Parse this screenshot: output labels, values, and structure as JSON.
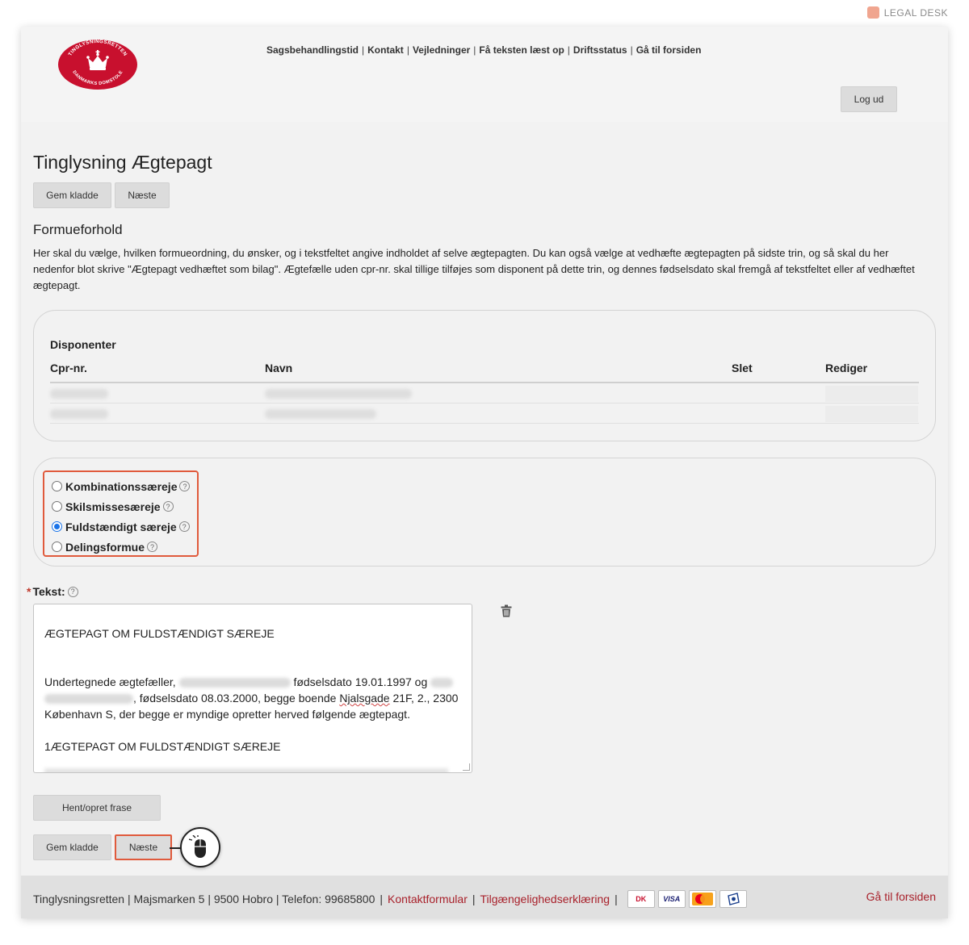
{
  "brand": {
    "legal_desk": "LEGAL DESK"
  },
  "logo": {
    "top_text": "TINGLYSNINGSRETTEN",
    "bottom_text": "DANMARKS DOMSTOLE"
  },
  "topnav": [
    "Sagsbehandlingstid",
    "Kontakt",
    "Vejledninger",
    "Få teksten læst op",
    "Driftsstatus",
    "Gå til forsiden"
  ],
  "header": {
    "logout": "Log ud"
  },
  "page": {
    "title": "Tinglysning Ægtepagt",
    "save_draft": "Gem kladde",
    "next": "Næste",
    "section_title": "Formueforhold",
    "description": "Her skal du vælge, hvilken formueordning, du ønsker, og i tekstfeltet angive indholdet af selve ægtepagten. Du kan også vælge at vedhæfte ægtepagten på sidste trin, og så skal du her nedenfor blot skrive \"Ægtepagt vedhæftet som bilag\". Ægtefælle uden cpr-nr. skal tillige tilføjes som disponent på dette trin, og dennes fødselsdato skal fremgå af tekstfeltet eller af vedhæftet ægtepagt."
  },
  "disponenter": {
    "title": "Disponenter",
    "columns": [
      "Cpr-nr.",
      "Navn",
      "Slet",
      "Rediger"
    ]
  },
  "formueordning": {
    "options": [
      {
        "label": "Kombinationssæreje",
        "checked": false
      },
      {
        "label": "Skilsmissesæreje",
        "checked": false
      },
      {
        "label": "Fuldstændigt særeje",
        "checked": true
      },
      {
        "label": "Delingsformue",
        "checked": false
      }
    ],
    "help_glyph": "?"
  },
  "tekst": {
    "label": "Tekst:",
    "required_marker": "*",
    "heading": "ÆGTEPAGT OM FULDSTÆNDIGT SÆREJE",
    "p_part1": "Undertegnede ægtefæller,",
    "p_part2": "fødselsdato 19.01.1997 og",
    "p_part3": ", fødselsdato 08.03.2000, begge boende",
    "p_street": "Njalsgade",
    "p_part4": "21F, 2., 2300 København S, der begge er myndige opretter herved følgende ægtepagt.",
    "section1": "1ÆGTEPAGT OM FULDSTÆNDIGT SÆREJE"
  },
  "actions": {
    "hent_opret_frase": "Hent/opret frase"
  },
  "footer": {
    "address": "Tinglysningsretten | Majsmarken 5 | 9500 Hobro | Telefon: 99685800",
    "contact_form": "Kontaktformular",
    "accessibility": "Tilgængelighedserklæring",
    "front_page": "Gå til forsiden",
    "cards": {
      "dk": "DK",
      "visa": "VISA",
      "mastercard": "MasterCard",
      "maestro": "Maestro"
    }
  },
  "colors": {
    "accent_red": "#a8202a",
    "highlight": "#e05a3c",
    "radio_blue": "#1a73e8"
  }
}
